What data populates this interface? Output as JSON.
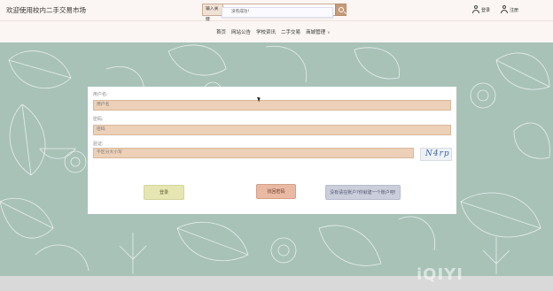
{
  "header": {
    "site_title": "欢迎使用校内二手交易市场",
    "search": {
      "category": "输入关键",
      "toast": "没有成功!"
    },
    "login_label": "登录",
    "register_label": "注册"
  },
  "nav": {
    "items": [
      {
        "label": "首页"
      },
      {
        "label": "网站公告"
      },
      {
        "label": "学校资讯"
      },
      {
        "label": "二手交易"
      },
      {
        "label": "商城管理"
      }
    ]
  },
  "form": {
    "username_label": "用户名:",
    "username_placeholder": "用户名",
    "password_label": "密码:",
    "password_placeholder": "密码",
    "captcha_label": "验证:",
    "captcha_placeholder": "不区分大小写",
    "captcha_image_text": "N4rp",
    "login_button": "登录",
    "forgot_button": "找回密码",
    "register_button": "没有请在账户?你就建一个账户吧!"
  },
  "watermark": "iQIYI",
  "colors": {
    "background": "#a8c2b8",
    "field": "#ecd0b8",
    "login_button": "#e6e6b2",
    "forgot_button": "#e9b9a3",
    "register_button": "#cbcfdc"
  }
}
